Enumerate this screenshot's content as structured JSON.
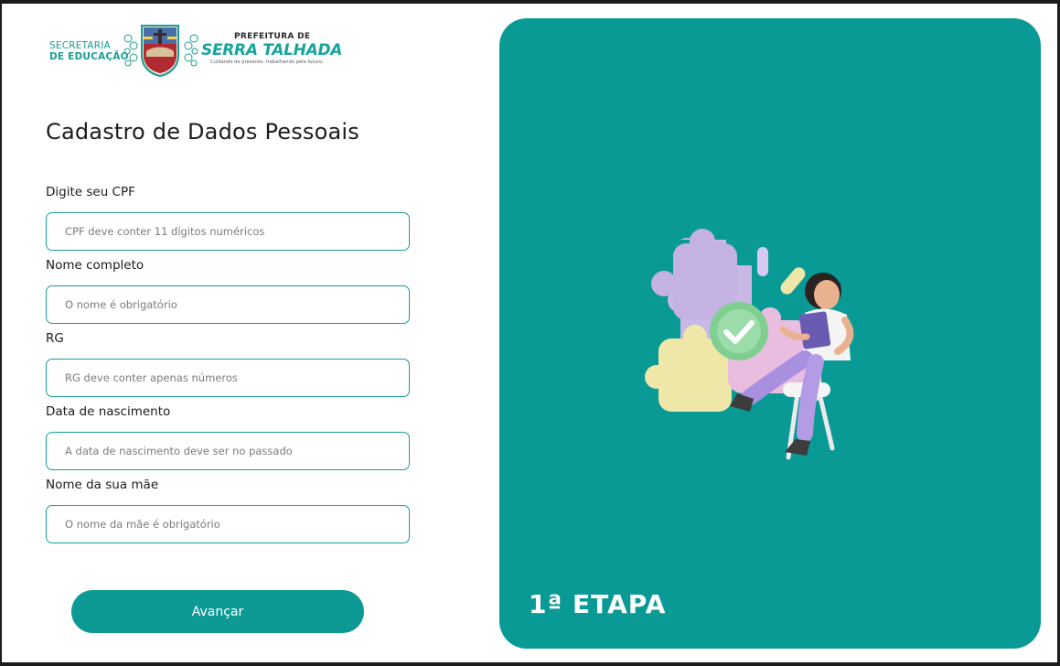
{
  "header": {
    "left_logo_line1": "SECRETARIA",
    "left_logo_line2": "DE EDUCAÇÃO",
    "right_logo_prefix": "PREFEITURA DE",
    "right_logo_city": "SERRA TALHADA",
    "right_logo_tagline": "Cuidando do presente, trabalhando pelo futuro."
  },
  "form": {
    "title": "Cadastro de Dados Pessoais",
    "fields": [
      {
        "label": "Digite seu CPF",
        "value": "",
        "placeholder": "CPF deve conter 11 dígitos numéricos"
      },
      {
        "label": "Nome completo",
        "value": "",
        "placeholder": "O nome é obrigatório"
      },
      {
        "label": "RG",
        "value": "",
        "placeholder": "RG deve conter apenas números"
      },
      {
        "label": "Data de nascimento",
        "value": "",
        "placeholder": "A data de nascimento deve ser no passado"
      },
      {
        "label": "Nome da sua mãe",
        "value": "",
        "placeholder": "O nome da mãe é obrigatório"
      }
    ],
    "submit_label": "Avançar"
  },
  "panel": {
    "stage_label": "1ª ETAPA",
    "illustration_icon": "woman-with-puzzle-checkmark-illustration"
  },
  "colors": {
    "accent": "#0a9a96",
    "input_border": "#1b9d97",
    "city_text": "#15a59c"
  }
}
